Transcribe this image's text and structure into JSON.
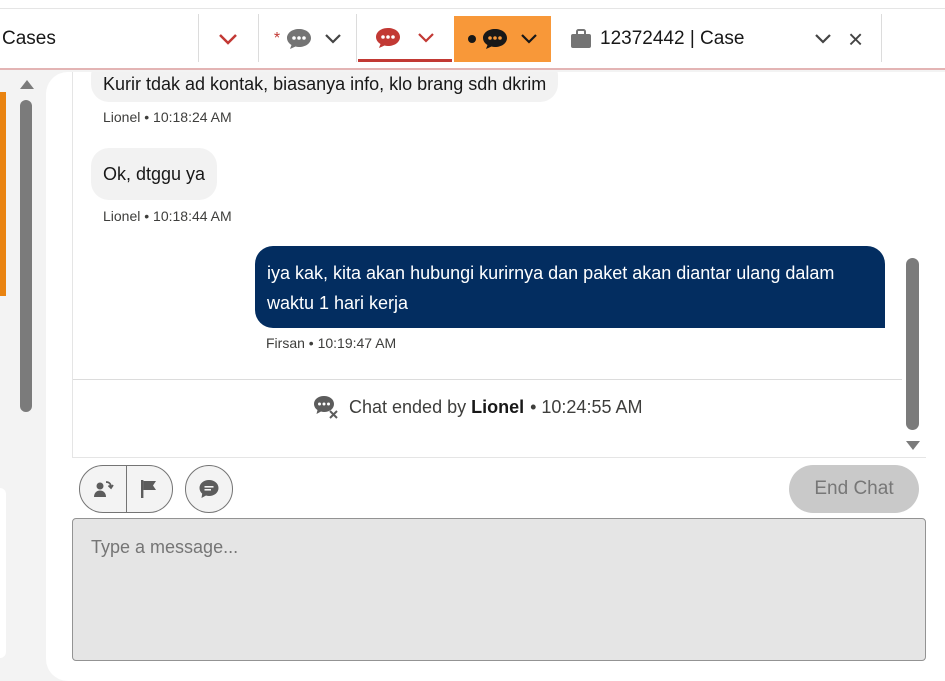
{
  "tabs": {
    "cases_label": "Cases",
    "typing_marker": "*",
    "case_title": "12372442 | Case",
    "close_glyph": "×"
  },
  "messages": [
    {
      "text": "Kurir tdak ad kontak, biasanya info, klo brang sdh dkrim",
      "sender": "Lionel",
      "time": "10:18:24 AM",
      "meta": "Lionel • 10:18:24 AM"
    },
    {
      "text": "Ok, dtggu ya",
      "sender": "Lionel",
      "time": "10:18:44 AM",
      "meta": "Lionel • 10:18:44 AM"
    },
    {
      "text": "iya kak, kita akan hubungi kurirnya dan paket akan diantar ulang dalam waktu 1 hari kerja",
      "sender": "Firsan",
      "time": "10:19:47 AM",
      "meta": "Firsan • 10:19:47 AM"
    }
  ],
  "chat_ended": {
    "prefix": "Chat ended by",
    "agent": "Lionel",
    "time": "• 10:24:55 AM"
  },
  "toolbar": {
    "end_chat_label": "End Chat"
  },
  "composer": {
    "placeholder": "Type a message..."
  },
  "colors": {
    "accent_red": "#c23934",
    "orange_tab": "#f89839",
    "outgoing_bubble": "#032d60"
  }
}
